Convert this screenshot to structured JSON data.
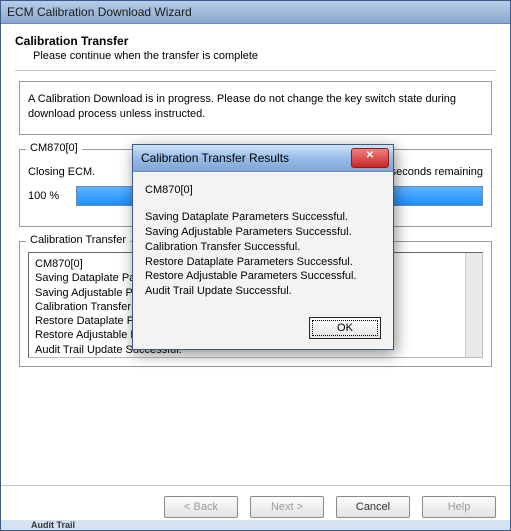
{
  "window": {
    "title": "ECM Calibration Download Wizard"
  },
  "header": {
    "heading": "Calibration Transfer",
    "subheading": "Please continue when the transfer is complete"
  },
  "warning_box": {
    "text": "A Calibration Download is in progress.  Please do not change the key switch state during download process unless instructed."
  },
  "device_group": {
    "caption": "CM870[0]",
    "status_left": "Closing ECM.",
    "status_right": "0 seconds remaining",
    "progress_label": "100 %"
  },
  "log_group": {
    "caption": "Calibration Transfer",
    "lines": [
      "CM870[0]",
      "Saving Dataplate Parameters Successful.",
      "Saving Adjustable Parameters Successful.",
      "Calibration Transfer Successful.",
      "Restore Dataplate Parameters Successful.",
      "Restore Adjustable Parameters Successful.",
      "Audit Trail Update Successful."
    ]
  },
  "buttons": {
    "back": "< Back",
    "next": "Next >",
    "cancel": "Cancel",
    "help": "Help"
  },
  "dialog": {
    "title": "Calibration Transfer Results",
    "close_glyph": "✕",
    "device": "CM870[0]",
    "lines": [
      "Saving Dataplate Parameters Successful.",
      "Saving Adjustable Parameters Successful.",
      "Calibration Transfer Successful.",
      "Restore Dataplate Parameters Successful.",
      "Restore Adjustable Parameters Successful.",
      "Audit Trail Update Successful."
    ],
    "ok": "OK"
  },
  "garbage": {
    "text": "Audit Trail"
  }
}
